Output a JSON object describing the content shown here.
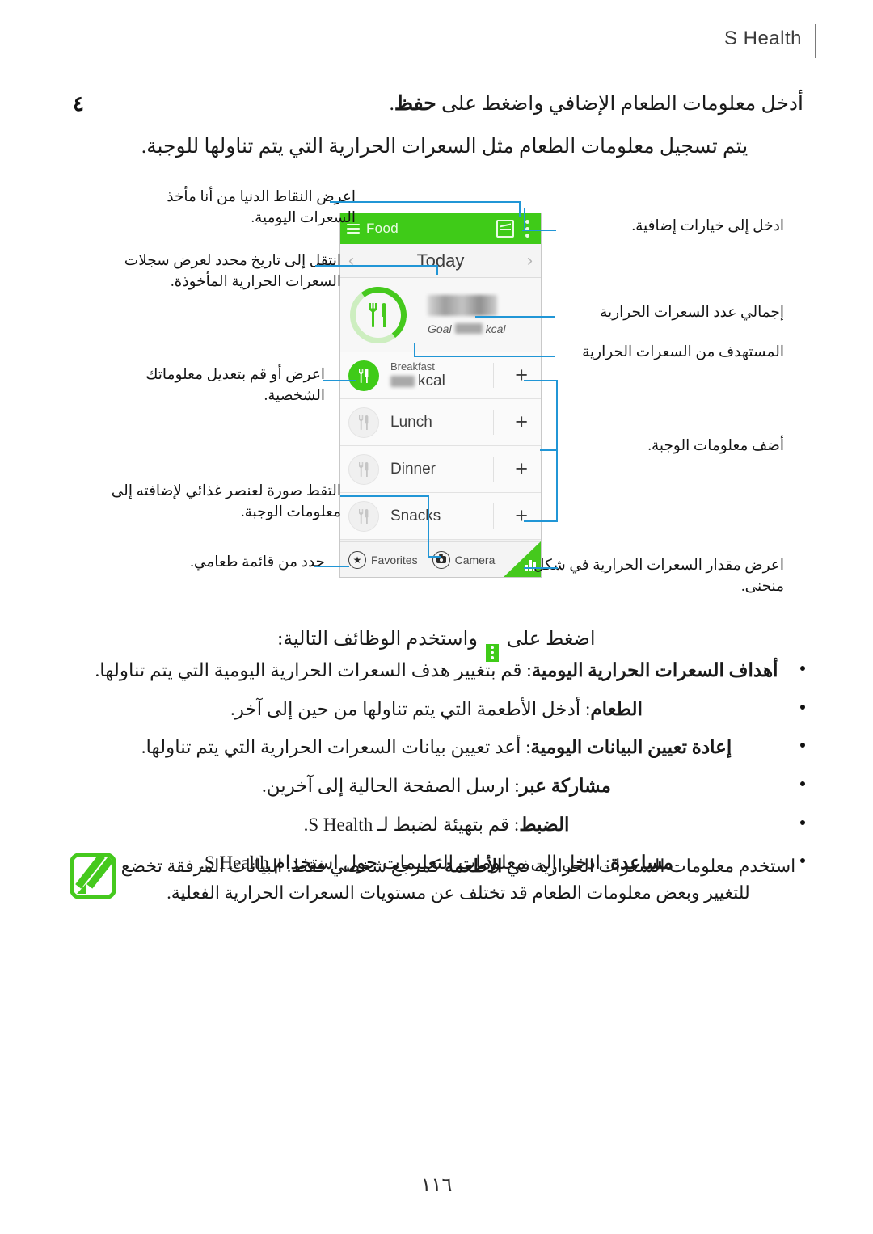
{
  "header": {
    "title": "S Health"
  },
  "step": {
    "number": "٤",
    "text_before": "أدخل معلومات الطعام الإضافي واضغط على ",
    "bold": "حفظ",
    "text_after": ".",
    "subtitle": "يتم تسجيل معلومات الطعام مثل السعرات الحرارية التي يتم تناولها للوجبة."
  },
  "phone": {
    "app_title": "Food",
    "menu_icon": "kebab-menu-icon",
    "chart_icon": "chart-icon",
    "hamburger_icon": "hamburger-icon",
    "date_label": "Today",
    "prev_arrow": "‹",
    "next_arrow": "›",
    "goal_prefix": "Goal",
    "goal_unit": "kcal",
    "meals": [
      {
        "name": "Breakfast",
        "unit": "kcal",
        "active": true
      },
      {
        "name": "Lunch",
        "unit": "",
        "active": false
      },
      {
        "name": "Dinner",
        "unit": "",
        "active": false
      },
      {
        "name": "Snacks",
        "unit": "",
        "active": false
      }
    ],
    "bottom": {
      "favorites": "Favorites",
      "camera": "Camera"
    }
  },
  "callouts": {
    "left": [
      "اعرض النقاط الدنيا من أنا مأخذ السعرات اليومية.",
      "انتقل إلى تاريخ محدد لعرض سجلات السعرات الحرارية المأخوذة.",
      "اعرض أو قم بتعديل معلوماتك الشخصية.",
      "التقط صورة لعنصر غذائي لإضافته إلى معلومات الوجبة.",
      "حدد من قائمة طعامي."
    ],
    "right": [
      "ادخل إلى خيارات إضافية.",
      "إجمالي عدد السعرات الحرارية",
      "المستهدف من السعرات الحرارية",
      "أضف معلومات الوجبة.",
      "اعرض مقدار السعرات الحرارية في شكل منحنى."
    ]
  },
  "press_line": {
    "before": "اضغط على ",
    "after": " واستخدم الوظائف التالية:"
  },
  "functions": [
    {
      "title": "أهداف السعرات الحرارية اليومية",
      "desc": ": قم بتغيير هدف السعرات الحرارية اليومية التي يتم تناولها."
    },
    {
      "title": "الطعام",
      "desc": ": أدخل الأطعمة التي يتم تناولها من حين إلى آخر."
    },
    {
      "title": "إعادة تعيين البيانات اليومية",
      "desc": ": أعد تعيين بيانات السعرات الحرارية التي يتم تناولها."
    },
    {
      "title": "مشاركة عبر",
      "desc": ": ارسل الصفحة الحالية إلى آخرين."
    },
    {
      "title": "الضبط",
      "desc": ": قم بتهيئة لضبط لـ S Health."
    },
    {
      "title": "مساعدة",
      "desc": ": ادخل إلى معلومات التعليمات حول استخدام S Health."
    }
  ],
  "note": {
    "icon": "note-pencil-icon",
    "line1_a": "استخدم معلومات السعرات الحرارية في ",
    "line1_b": "الأطعمة",
    "line1_c": " كمرجع شخصي فقط. البيانات المرفقة تخضع للتغيير",
    "line2": "وبعض معلومات الطعام قد تختلف عن مستويات السعرات الحرارية الفعلية."
  },
  "page_number": "١١٦",
  "colors": {
    "brand_green": "#3fcb18",
    "ring_green": "#45c91d",
    "lead_blue": "#2196d6"
  }
}
